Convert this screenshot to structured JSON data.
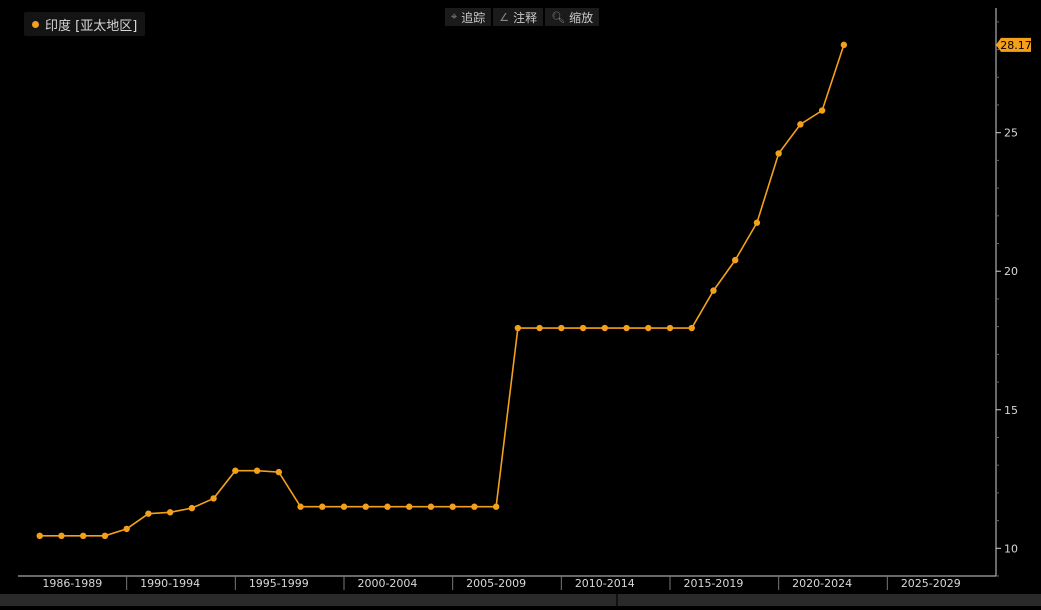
{
  "legend": {
    "label": "印度 [亚太地区]",
    "color": "#f5a01a"
  },
  "toolbar": [
    {
      "icon": "crosshair-icon",
      "glyph": "⌖",
      "label": "追踪"
    },
    {
      "icon": "pencil-icon",
      "glyph": "∠",
      "label": "注释"
    },
    {
      "icon": "zoom-icon",
      "glyph": "🔍︎",
      "label": "缩放"
    }
  ],
  "colors": {
    "line": "#f5a01a",
    "axis": "#d0d0d0",
    "background": "#000000",
    "last_value_bg": "#f5a01a"
  },
  "chart_data": {
    "type": "line",
    "series": [
      {
        "name": "印度 [亚太地区]",
        "x": [
          1986,
          1987,
          1988,
          1989,
          1990,
          1991,
          1992,
          1993,
          1994,
          1995,
          1996,
          1997,
          1998,
          1999,
          2000,
          2001,
          2002,
          2003,
          2004,
          2005,
          2006,
          2007,
          2008,
          2009,
          2010,
          2011,
          2012,
          2013,
          2014,
          2015,
          2016,
          2017,
          2018,
          2019,
          2020,
          2021,
          2022
        ],
        "values": [
          10.45,
          10.45,
          10.45,
          10.45,
          10.7,
          11.25,
          11.3,
          11.45,
          11.8,
          12.8,
          12.8,
          12.75,
          11.5,
          11.5,
          11.5,
          11.5,
          11.5,
          11.5,
          11.5,
          11.5,
          11.5,
          11.5,
          17.95,
          17.95,
          17.95,
          17.95,
          17.95,
          17.95,
          17.95,
          17.95,
          17.95,
          19.3,
          20.4,
          21.75,
          24.25,
          25.3,
          25.8
        ]
      }
    ],
    "last_point": {
      "x": 2023,
      "value": 28.17
    },
    "last_value_label": "28.17",
    "yticks": [
      10,
      15,
      20,
      25
    ],
    "ylim": [
      9,
      29.5
    ],
    "xlim": [
      1985,
      2030
    ],
    "xgroups": [
      "1986-1989",
      "1990-1994",
      "1995-1999",
      "2000-2004",
      "2005-2009",
      "2010-2014",
      "2015-2019",
      "2020-2024",
      "2025-2029"
    ],
    "xgroup_centers": [
      1987.5,
      1992,
      1997,
      2002,
      2007,
      2012,
      2017,
      2022,
      2027
    ],
    "xgroup_separators": [
      1990,
      1995,
      2000,
      2005,
      2010,
      2015,
      2020,
      2025
    ],
    "y_axis_side": "right",
    "grid": false
  }
}
